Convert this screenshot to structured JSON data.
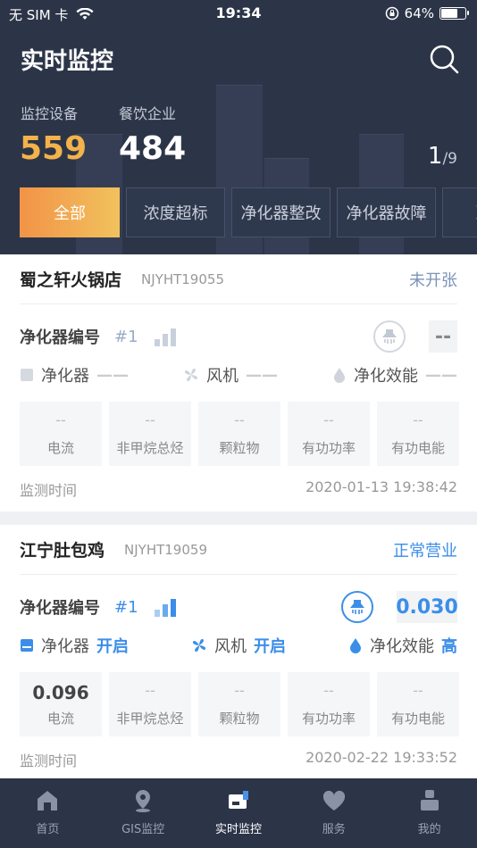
{
  "status_bar": {
    "carrier": "无 SIM 卡",
    "time": "19:34",
    "battery": "64%"
  },
  "header": {
    "title": "实时监控",
    "stats": [
      {
        "label": "监控设备",
        "value": "559",
        "color": "#f3b24a"
      },
      {
        "label": "餐饮企业",
        "value": "484",
        "color": "#ffffff"
      }
    ],
    "page_current": "1",
    "page_total": "/9"
  },
  "tabs": [
    "全部",
    "浓度超标",
    "净化器整改",
    "净化器故障",
    "净化"
  ],
  "cards": [
    {
      "name": "蜀之轩火锅店",
      "code": "NJYHT19055",
      "status": "未开张",
      "status_color": "#7d93b8",
      "purifier_label": "净化器编号",
      "purifier_num": "#1",
      "reading": "--",
      "purifier_label2": "净化器",
      "purifier_state": "——",
      "fan_label": "风机",
      "fan_state": "——",
      "efficiency_label": "净化效能",
      "efficiency_state": "——",
      "metrics": [
        {
          "value": "--",
          "label": "电流"
        },
        {
          "value": "--",
          "label": "非甲烷总烃"
        },
        {
          "value": "--",
          "label": "颗粒物"
        },
        {
          "value": "--",
          "label": "有功功率"
        },
        {
          "value": "--",
          "label": "有功电能"
        }
      ],
      "monitor_label": "监测时间",
      "monitor_time": "2020-01-13 19:38:42"
    },
    {
      "name": "江宁肚包鸡",
      "code": "NJYHT19059",
      "status": "正常营业",
      "status_color": "#3b8ee8",
      "purifier_label": "净化器编号",
      "purifier_num": "#1",
      "reading": "0.030",
      "purifier_label2": "净化器",
      "purifier_state": "开启",
      "fan_label": "风机",
      "fan_state": "开启",
      "efficiency_label": "净化效能",
      "efficiency_state": "高",
      "metrics": [
        {
          "value": "0.096",
          "label": "电流"
        },
        {
          "value": "--",
          "label": "非甲烷总烃"
        },
        {
          "value": "--",
          "label": "颗粒物"
        },
        {
          "value": "--",
          "label": "有功功率"
        },
        {
          "value": "--",
          "label": "有功电能"
        }
      ],
      "monitor_label": "监测时间",
      "monitor_time": "2020-02-22 19:33:52"
    }
  ],
  "tabbar": [
    {
      "label": "首页",
      "icon": "home-icon"
    },
    {
      "label": "GIS监控",
      "icon": "map-pin-icon"
    },
    {
      "label": "实时监控",
      "icon": "monitor-icon",
      "active": true
    },
    {
      "label": "服务",
      "icon": "heart-icon"
    },
    {
      "label": "我的",
      "icon": "user-icon"
    }
  ]
}
